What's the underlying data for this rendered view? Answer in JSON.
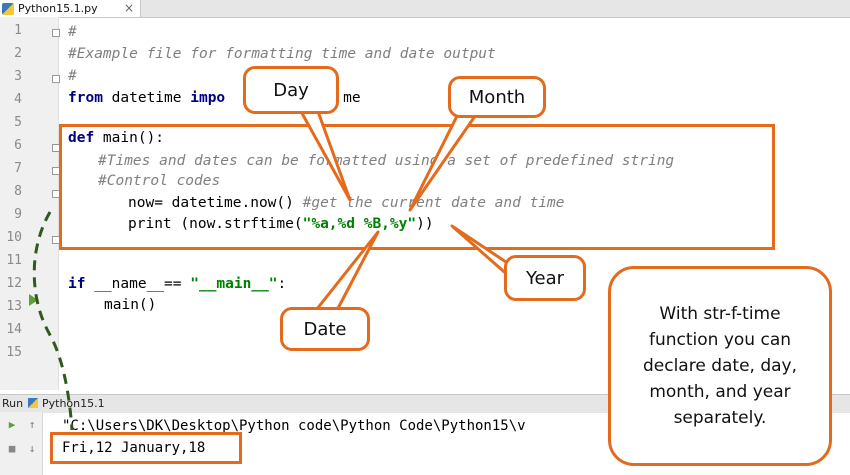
{
  "editor": {
    "tab_title": "Python15.1.py",
    "line_numbers": [
      "1",
      "2",
      "3",
      "4",
      "5",
      "6",
      "7",
      "8",
      "9",
      "10",
      "11",
      "12",
      "13",
      "14",
      "15"
    ],
    "code": {
      "l1": "#",
      "l2": "#Example file for formatting time and date output",
      "l3": "#",
      "l4_kw1": "from",
      "l4_rest1": " datetime ",
      "l4_kw2": "impo",
      "l4_rest2": "me",
      "l6_kw": "def",
      "l6_rest": " main():",
      "l7": "#Times and dates can be formatted using a set of predefined string",
      "l8": "#Control codes",
      "l9_code": "now= datetime.now() ",
      "l9_comment": "#get the current date and time",
      "l10_pre": "print (now.strftime(",
      "l10_str": "\"%a,%d %B,%y\"",
      "l10_post": "))",
      "l13_kw": "if",
      "l13_mid": " __name__== ",
      "l13_str": "\"__main__\"",
      "l13_end": ":",
      "l14": "main()"
    }
  },
  "run_panel": {
    "label": "Run",
    "tab_title": "Python15.1",
    "command": "\"C:\\Users\\DK\\Desktop\\Python code\\Python Code\\Python15\\v",
    "output": "Fri,12 January,18"
  },
  "annotations": {
    "day": "Day",
    "month": "Month",
    "year": "Year",
    "date": "Date",
    "note": "With str-f-time function you can declare date, day, month, and year separately."
  },
  "colors": {
    "accent": "#e46a1c",
    "run_arrow": "#5da03a",
    "dashed_line": "#2f5a1c"
  }
}
